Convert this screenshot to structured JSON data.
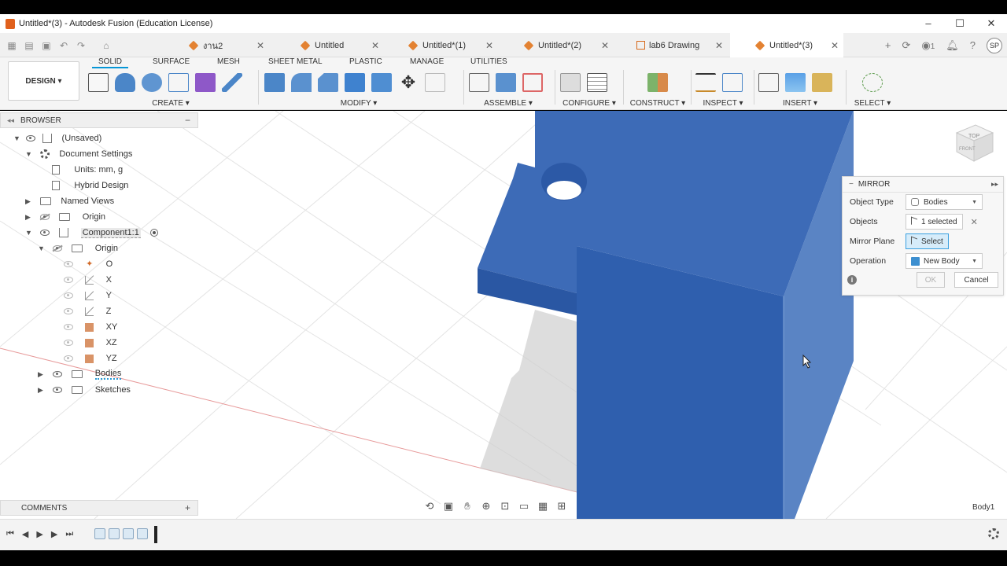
{
  "window": {
    "title": "Untitled*(3) - Autodesk Fusion (Education License)",
    "minimize": "–",
    "maximize": "☐",
    "close": "✕"
  },
  "tabs": [
    {
      "label": "งาน2",
      "icon": "cube-icon",
      "active": false
    },
    {
      "label": "Untitled",
      "icon": "cube-icon",
      "active": false
    },
    {
      "label": "Untitled*(1)",
      "icon": "cube-icon",
      "active": false
    },
    {
      "label": "Untitled*(2)",
      "icon": "cube-icon",
      "active": false
    },
    {
      "label": "lab6 Drawing",
      "icon": "drawing-icon",
      "active": false
    },
    {
      "label": "Untitled*(3)",
      "icon": "cube-icon",
      "active": true
    }
  ],
  "tab_close": "✕",
  "tab_bar_right": {
    "add": "+",
    "notification_count": "1",
    "avatar": "SP"
  },
  "ribbon": {
    "workspace": "DESIGN ▾",
    "tabs": [
      "SOLID",
      "SURFACE",
      "MESH",
      "SHEET METAL",
      "PLASTIC",
      "MANAGE",
      "UTILITIES"
    ],
    "active_tab": "SOLID",
    "groups": [
      {
        "label": "CREATE ▾"
      },
      {
        "label": "MODIFY ▾"
      },
      {
        "label": "ASSEMBLE ▾"
      },
      {
        "label": "CONFIGURE ▾"
      },
      {
        "label": "CONSTRUCT ▾"
      },
      {
        "label": "INSPECT ▾"
      },
      {
        "label": "INSERT ▾"
      },
      {
        "label": "SELECT ▾"
      }
    ]
  },
  "browser": {
    "title": "BROWSER",
    "items": [
      {
        "label": "(Unsaved)"
      },
      {
        "label": "Document Settings"
      },
      {
        "label": "Units: mm, g"
      },
      {
        "label": "Hybrid Design"
      },
      {
        "label": "Named Views"
      },
      {
        "label": "Origin"
      },
      {
        "label": "Component1:1"
      },
      {
        "label": "Origin"
      },
      {
        "label": "O"
      },
      {
        "label": "X"
      },
      {
        "label": "Y"
      },
      {
        "label": "Z"
      },
      {
        "label": "XY"
      },
      {
        "label": "XZ"
      },
      {
        "label": "YZ"
      },
      {
        "label": "Bodies"
      },
      {
        "label": "Sketches"
      }
    ]
  },
  "comments": {
    "title": "COMMENTS",
    "add": "+"
  },
  "mirror": {
    "title": "MIRROR",
    "object_type_label": "Object Type",
    "object_type_value": "Bodies",
    "objects_label": "Objects",
    "objects_value": "1 selected",
    "mirror_plane_label": "Mirror Plane",
    "mirror_plane_value": "Select",
    "operation_label": "Operation",
    "operation_value": "New Body",
    "ok": "OK",
    "cancel": "Cancel"
  },
  "viewcube": {
    "top": "TOP",
    "front": "FRONT"
  },
  "status": {
    "body_label": "Body1"
  },
  "colors": {
    "accent": "#0696d7",
    "body_front": "#2f5fae",
    "body_side": "#5a84c4",
    "body_top": "#3e6db8"
  }
}
